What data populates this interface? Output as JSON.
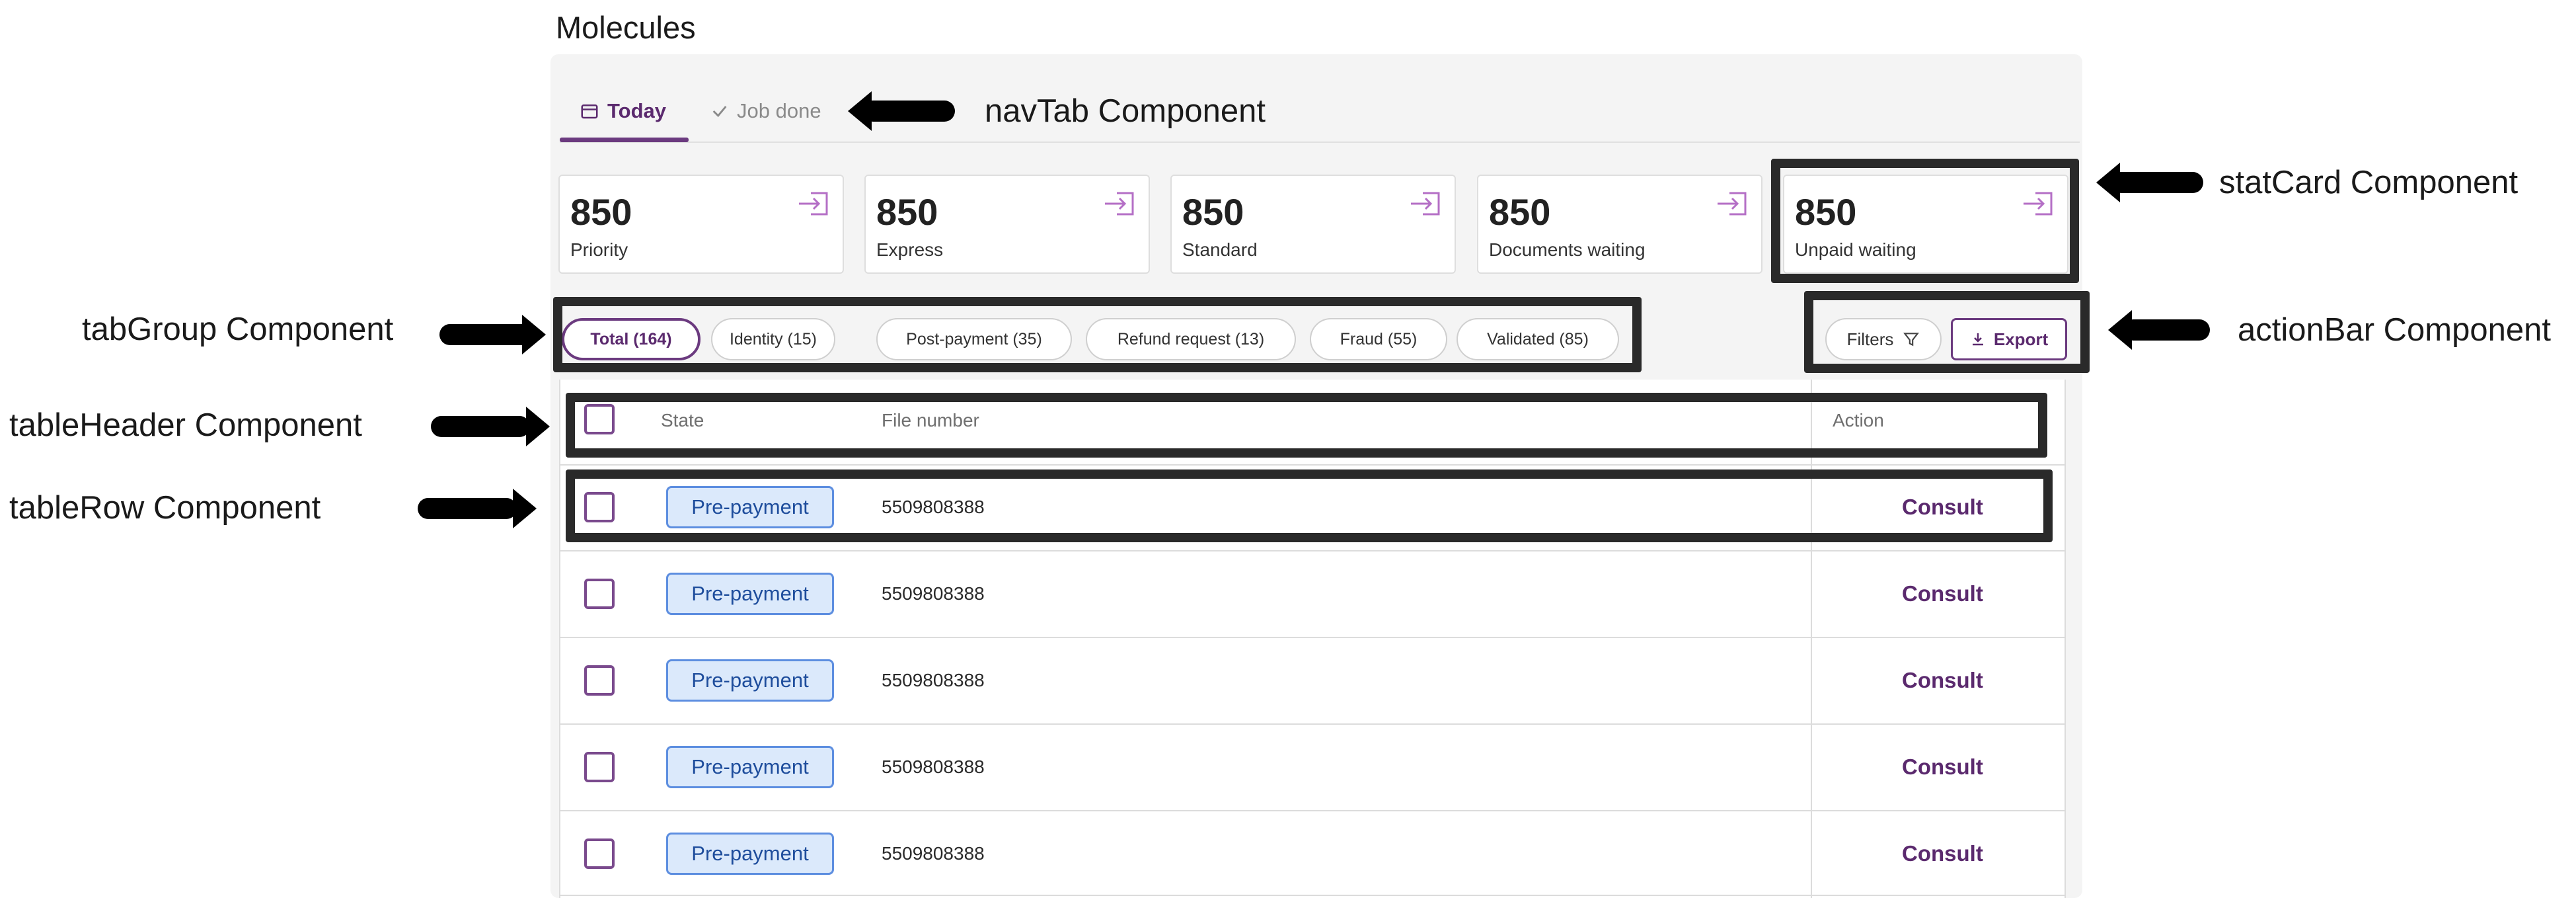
{
  "page_title": "Molecules",
  "nav_tabs": [
    {
      "label": "Today",
      "icon": "calendar-icon",
      "active": true
    },
    {
      "label": "Job done",
      "icon": "check-icon",
      "active": false
    }
  ],
  "stat_cards": [
    {
      "value": "850",
      "label": "Priority",
      "icon": "login-icon"
    },
    {
      "value": "850",
      "label": "Express",
      "icon": "login-icon"
    },
    {
      "value": "850",
      "label": "Standard",
      "icon": "login-icon"
    },
    {
      "value": "850",
      "label": "Documents waiting",
      "icon": "login-icon"
    },
    {
      "value": "850",
      "label": "Unpaid waiting",
      "icon": "login-icon"
    }
  ],
  "filter_tabs": [
    {
      "label": "Total (164)",
      "active": true
    },
    {
      "label": "Identity (15)",
      "active": false
    },
    {
      "label": "Post-payment (35)",
      "active": false
    },
    {
      "label": "Refund request (13)",
      "active": false
    },
    {
      "label": "Fraud (55)",
      "active": false
    },
    {
      "label": "Validated (85)",
      "active": false
    }
  ],
  "action_bar": {
    "filters_label": "Filters",
    "export_label": "Export"
  },
  "table": {
    "headers": {
      "state": "State",
      "file_number": "File number",
      "action": "Action"
    },
    "rows": [
      {
        "state": "Pre-payment",
        "file_number": "5509808388",
        "action": "Consult"
      },
      {
        "state": "Pre-payment",
        "file_number": "5509808388",
        "action": "Consult"
      },
      {
        "state": "Pre-payment",
        "file_number": "5509808388",
        "action": "Consult"
      },
      {
        "state": "Pre-payment",
        "file_number": "5509808388",
        "action": "Consult"
      },
      {
        "state": "Pre-payment",
        "file_number": "5509808388",
        "action": "Consult"
      }
    ]
  },
  "annotations": {
    "nav_tab": "navTab Component",
    "stat_card": "statCard Component",
    "tab_group": "tabGroup Component",
    "action_bar": "actionBar Component",
    "table_header": "tableHeader Component",
    "table_row": "tableRow Component"
  },
  "colors": {
    "accent": "#6b3a7f",
    "chip_bg": "#dbe9fb",
    "chip_border": "#5d8ee0",
    "annotation_box": "#2a2a2a"
  }
}
